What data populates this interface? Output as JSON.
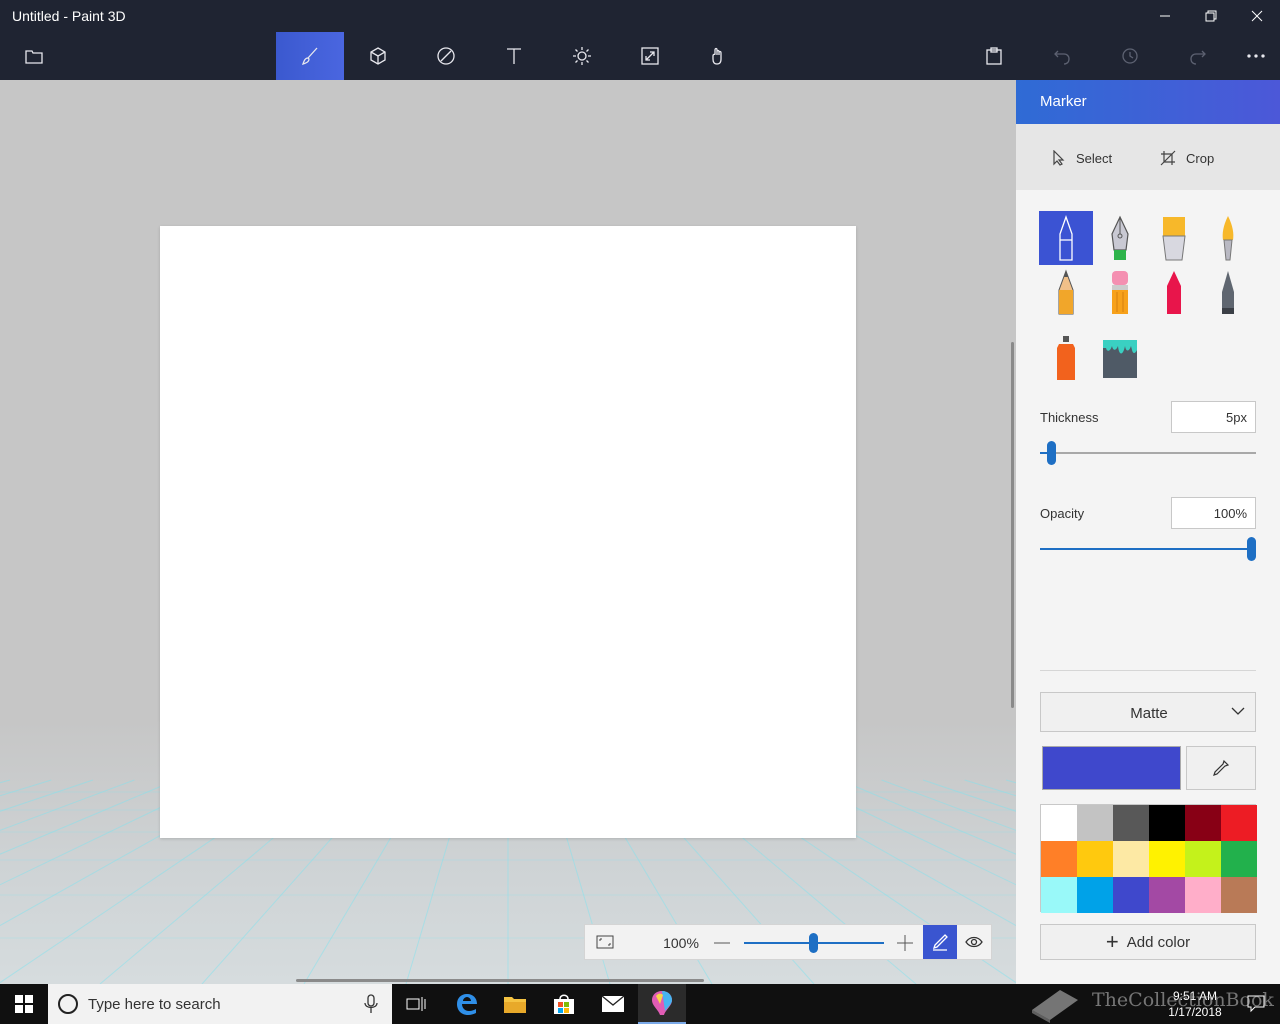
{
  "window": {
    "title": "Untitled - Paint 3D",
    "minimize": "minimize",
    "maximize": "restore",
    "close": "close"
  },
  "toolbar": {
    "menu_icon": "folder-icon",
    "tools": [
      {
        "name": "brushes",
        "icon": "brush-icon",
        "active": true
      },
      {
        "name": "3d-shapes",
        "icon": "cube-icon",
        "active": false
      },
      {
        "name": "2d-shapes",
        "icon": "shapes-icon",
        "active": false
      },
      {
        "name": "text",
        "icon": "text-icon",
        "active": false
      },
      {
        "name": "effects",
        "icon": "sun-icon",
        "active": false
      },
      {
        "name": "canvas",
        "icon": "canvas-resize-icon",
        "active": false
      },
      {
        "name": "stickers",
        "icon": "sticker-icon",
        "active": false
      }
    ],
    "right": [
      "paste-icon",
      "undo-icon",
      "history-icon",
      "redo-icon",
      "more-icon"
    ]
  },
  "canvas": {
    "zoom": "100%",
    "zoom_level": 0.5
  },
  "panel": {
    "title": "Marker",
    "select_label": "Select",
    "crop_label": "Crop",
    "tools": [
      {
        "name": "marker",
        "active": true
      },
      {
        "name": "calligraphy-pen"
      },
      {
        "name": "oil-brush"
      },
      {
        "name": "watercolor"
      },
      {
        "name": "pencil"
      },
      {
        "name": "eraser"
      },
      {
        "name": "crayon"
      },
      {
        "name": "pixel-pen"
      },
      {
        "name": "spray-can"
      },
      {
        "name": "fill"
      }
    ],
    "thickness_label": "Thickness",
    "thickness_value": "5px",
    "thickness_level": 0.05,
    "opacity_label": "Opacity",
    "opacity_value": "100%",
    "opacity_level": 1.0,
    "finish": "Matte",
    "current_color": "#3f48cc",
    "palette": [
      "#ffffff",
      "#c3c3c3",
      "#585858",
      "#000000",
      "#880015",
      "#ed1c24",
      "#ff7f27",
      "#ffc90e",
      "#fde9a4",
      "#fff200",
      "#c4f21b",
      "#22b14c",
      "#99f9f9",
      "#00a2e8",
      "#3f48cc",
      "#a349a4",
      "#ffaec9",
      "#b97a57"
    ],
    "add_color_label": "Add color"
  },
  "taskbar": {
    "search_placeholder": "Type here to search",
    "time": "9:51 AM",
    "date": "1/17/2018",
    "apps": [
      "task-view-icon",
      "edge-icon",
      "file-explorer-icon",
      "store-icon",
      "mail-icon",
      "paint3d-icon"
    ]
  },
  "watermark": "TheCollectionBook"
}
